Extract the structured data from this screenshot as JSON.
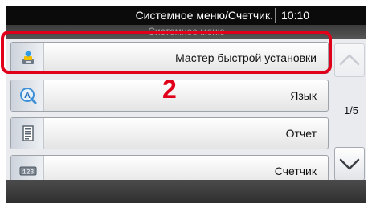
{
  "status_bar": {
    "title": "Системное меню/Счетчик.",
    "time": "10:10"
  },
  "header": {
    "title": "Системное меню"
  },
  "menu": {
    "items": [
      {
        "label": "Мастер быстрой установки",
        "icon": "wizard-icon"
      },
      {
        "label": "Язык",
        "icon": "language-icon"
      },
      {
        "label": "Отчет",
        "icon": "report-icon"
      },
      {
        "label": "Счетчик",
        "icon": "counter-icon"
      }
    ]
  },
  "pagination": {
    "page_indicator": "1/5"
  },
  "annotation": {
    "step_number": "2",
    "highlight_color": "#e1001a"
  }
}
